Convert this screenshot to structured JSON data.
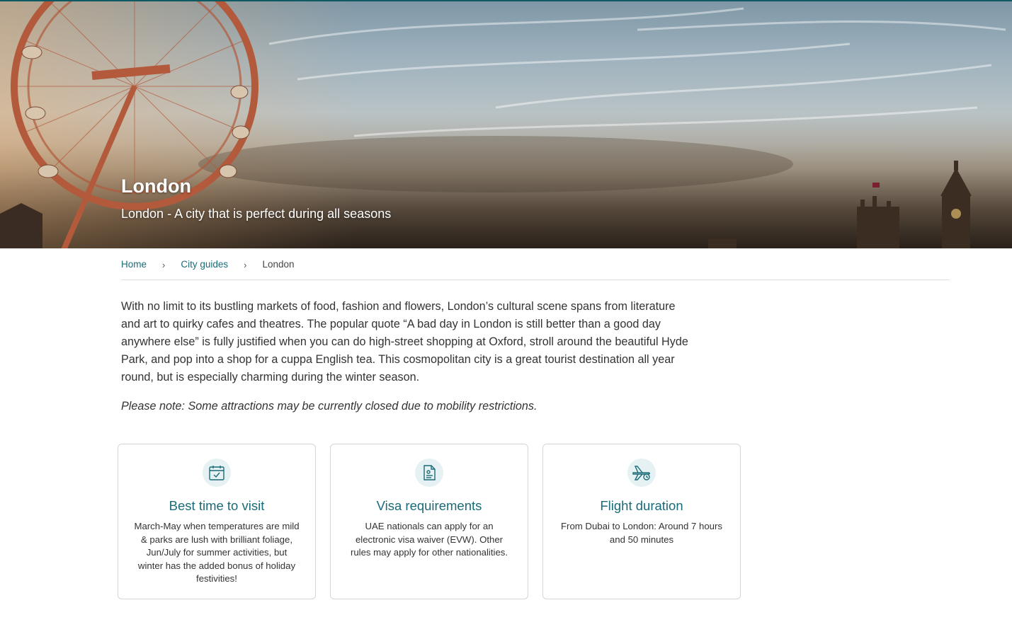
{
  "hero": {
    "title": "London",
    "subtitle": "London - A city that is perfect during all seasons"
  },
  "breadcrumb": {
    "items": [
      {
        "label": "Home"
      },
      {
        "label": "City guides"
      },
      {
        "label": "London"
      }
    ],
    "separator": "›"
  },
  "content": {
    "intro": "With no limit to its bustling markets of food, fashion and flowers, London’s cultural scene spans from literature and art to quirky cafes and theatres. The popular quote “A bad day in London is still better than a good day anywhere else” is fully justified when you can do high-street shopping at Oxford, stroll around the beautiful Hyde Park, and pop into a shop for a cuppa English tea. This cosmopolitan city is a great tourist destination all year round, but is especially charming during the winter season.",
    "note": "Please note: Some attractions may be currently closed due to mobility restrictions."
  },
  "cards": [
    {
      "icon": "calendar-icon",
      "title": "Best time to visit",
      "text": "March-May when temperatures are mild & parks are lush with brilliant foliage, Jun/July for summer activities, but winter has the added bonus of holiday festivities!"
    },
    {
      "icon": "visa-document-icon",
      "title": "Visa requirements",
      "text": "UAE nationals can apply for an electronic visa waiver (EVW). Other rules may apply for other nationalities."
    },
    {
      "icon": "airplane-clock-icon",
      "title": "Flight duration",
      "text": "From Dubai to London: Around 7 hours and 50 minutes"
    }
  ],
  "colors": {
    "accent": "#1a6b77",
    "icon_bg": "#e6f1f3",
    "card_border": "#d6d6d6"
  }
}
